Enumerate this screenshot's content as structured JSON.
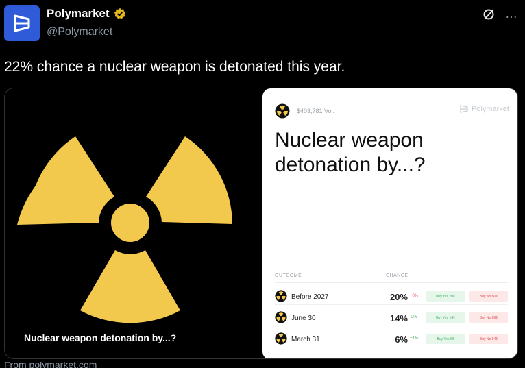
{
  "post": {
    "author_name": "Polymarket",
    "author_handle": "@Polymarket",
    "text": "22% chance a nuclear weapon is detonated this year.",
    "more_icon": "…",
    "footer_text": "From polymarket.com"
  },
  "card": {
    "left_caption": "Nuclear weapon detonation by...?",
    "volume": "$403,781 Vol.",
    "brand": "Polymarket",
    "title": "Nuclear weapon detonation by...?",
    "headers": {
      "outcome": "OUTCOME",
      "chance": "CHANCE"
    },
    "rows": [
      {
        "label": "Before 2027",
        "chance": "20%",
        "change": "+0%",
        "yes": "Buy Yes 20¢",
        "no": "Buy No 80¢"
      },
      {
        "label": "June 30",
        "chance": "14%",
        "change": "-2%",
        "yes": "Buy Yes 14¢",
        "no": "Buy No 86¢"
      },
      {
        "label": "March 31",
        "chance": "6%",
        "change": "+1%",
        "yes": "Buy Yes 6¢",
        "no": "Buy No 94¢"
      }
    ]
  },
  "colors": {
    "avatar_bg": "#2f5bd9",
    "radiation_yellow": "#f2c94c",
    "yes_green": "#46b266",
    "no_red": "#e0505a"
  },
  "icons": [
    "polymarket-logo-icon",
    "verified-badge-icon",
    "grok-icon",
    "more-icon",
    "radiation-icon"
  ]
}
